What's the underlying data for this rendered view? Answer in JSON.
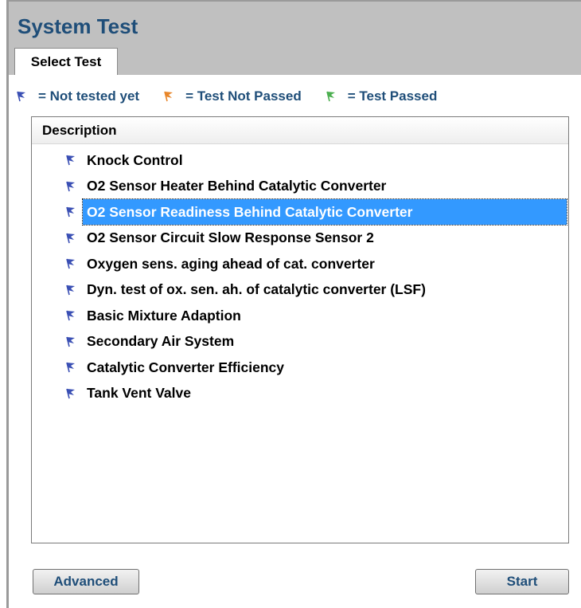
{
  "window": {
    "title": "System Test"
  },
  "tabs": [
    {
      "label": "Select Test",
      "active": true
    }
  ],
  "legend": [
    {
      "label": "= Not tested yet",
      "icon": "flag-icon",
      "color": "#3a4fb4"
    },
    {
      "label": "= Test Not Passed",
      "icon": "flag-icon",
      "color": "#e8862a"
    },
    {
      "label": "= Test Passed",
      "icon": "flag-icon",
      "color": "#4caf50"
    }
  ],
  "list": {
    "header": "Description",
    "selected_index": 2,
    "items": [
      {
        "label": "Knock Control",
        "status": "not_tested"
      },
      {
        "label": "O2 Sensor Heater Behind Catalytic Converter",
        "status": "not_tested"
      },
      {
        "label": "O2 Sensor Readiness Behind Catalytic Converter",
        "status": "not_tested"
      },
      {
        "label": "O2 Sensor Circuit Slow Response Sensor 2",
        "status": "not_tested"
      },
      {
        "label": "Oxygen sens. aging ahead of cat. converter",
        "status": "not_tested"
      },
      {
        "label": "Dyn. test of ox. sen. ah. of catalytic converter (LSF)",
        "status": "not_tested"
      },
      {
        "label": "Basic Mixture Adaption",
        "status": "not_tested"
      },
      {
        "label": "Secondary Air System",
        "status": "not_tested"
      },
      {
        "label": "Catalytic Converter Efficiency",
        "status": "not_tested"
      },
      {
        "label": "Tank Vent Valve",
        "status": "not_tested"
      }
    ]
  },
  "buttons": {
    "advanced_label": "Advanced",
    "start_label": "Start"
  },
  "colors": {
    "title": "#1f4e79",
    "header_bg": "#c0c0c0",
    "selection": "#3399ff",
    "flag_not_tested": "#3a4fb4"
  }
}
